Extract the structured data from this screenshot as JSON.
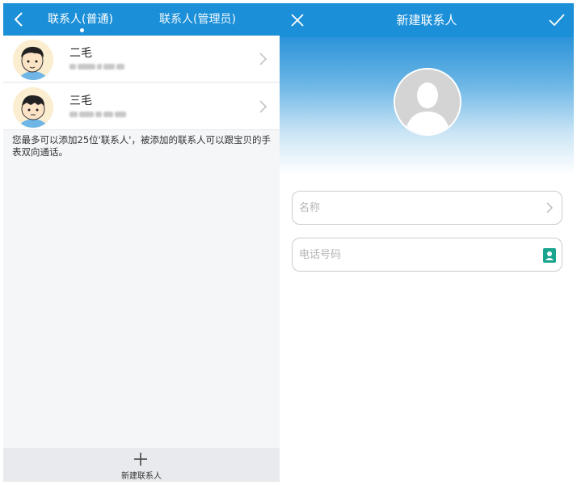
{
  "left": {
    "tabs": [
      {
        "label": "联系人(普通)",
        "active": true
      },
      {
        "label": "联系人(管理员)",
        "active": false
      }
    ],
    "contacts": [
      {
        "name": "二毛"
      },
      {
        "name": "三毛"
      }
    ],
    "hint": "您最多可以添加25位'联系人'，被添加的联系人可以跟宝贝的手表双向通话。",
    "add_contact_label": "新建联系人"
  },
  "right": {
    "title": "新建联系人",
    "name_placeholder": "名称",
    "phone_placeholder": "电话号码"
  },
  "colors": {
    "header_blue": "#1b8fd8",
    "contact_book_green": "#1aa58f"
  }
}
